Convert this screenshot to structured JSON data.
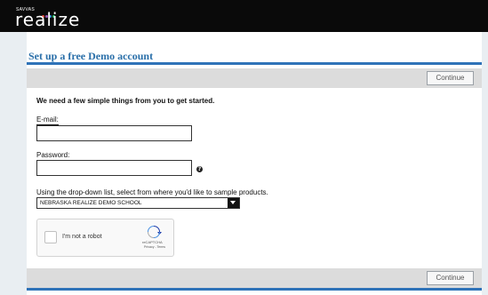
{
  "header": {
    "brand_small": "SAVVAS",
    "brand": "realize",
    "dot_colors": [
      "#e74c3c",
      "#9b59b6",
      "#3498db",
      "#2ecc71"
    ]
  },
  "page": {
    "title": "Set up a free Demo account",
    "continue_label": "Continue",
    "intro": "We need a few simple things from you to get started."
  },
  "form": {
    "email_label": "E-mail:",
    "email_value": "",
    "password_label": "Password:",
    "password_value": "",
    "help_icon": "?",
    "dropdown_label": "Using the drop-down list, select from where you'd like to sample products.",
    "dropdown_value": "NEBRASKA REALIZE DEMO SCHOOL"
  },
  "captcha": {
    "label": "I'm not a robot",
    "brand": "reCAPTCHA",
    "links": "Privacy - Terms"
  },
  "colors": {
    "accent": "#2f73b8",
    "title": "#2a6fa9",
    "topbar": "#0a0a0a",
    "toolbar": "#dcdcdc"
  }
}
